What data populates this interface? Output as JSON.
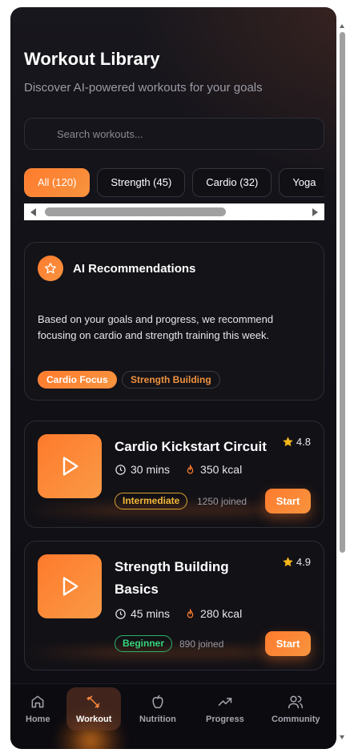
{
  "header": {
    "title": "Workout Library",
    "subtitle": "Discover AI-powered workouts for your goals"
  },
  "search": {
    "placeholder": "Search workouts...",
    "value": ""
  },
  "filters": [
    {
      "label": "All (120)",
      "active": true
    },
    {
      "label": "Strength (45)",
      "active": false
    },
    {
      "label": "Cardio (32)",
      "active": false
    },
    {
      "label": "Yoga",
      "active": false
    }
  ],
  "ai_card": {
    "icon": "star-icon",
    "title": "AI Recommendations",
    "text": "Based on your goals and progress, we recommend focusing on cardio and strength training this week.",
    "tags": [
      "Cardio Focus",
      "Strength Building"
    ]
  },
  "workouts": [
    {
      "title": "Cardio Kickstart Circuit",
      "rating": "4.8",
      "duration": "30 mins",
      "calories": "350 kcal",
      "level": "Intermediate",
      "joined": "1250 joined",
      "button": "Start"
    },
    {
      "title": "Strength Building Basics",
      "rating": "4.9",
      "duration": "45 mins",
      "calories": "280 kcal",
      "level": "Beginner",
      "joined": "890 joined",
      "button": "Start"
    }
  ],
  "nav": [
    {
      "label": "Home",
      "icon": "home-icon"
    },
    {
      "label": "Workout",
      "icon": "dumbbell-icon",
      "active": true
    },
    {
      "label": "Nutrition",
      "icon": "apple-icon"
    },
    {
      "label": "Progress",
      "icon": "trending-up-icon"
    },
    {
      "label": "Community",
      "icon": "users-icon"
    }
  ],
  "colors": {
    "accent": "#ff7b2e",
    "background": "#121118",
    "star": "#f5b71b",
    "intermediate": "#f5b93a",
    "beginner": "#34d67a"
  }
}
